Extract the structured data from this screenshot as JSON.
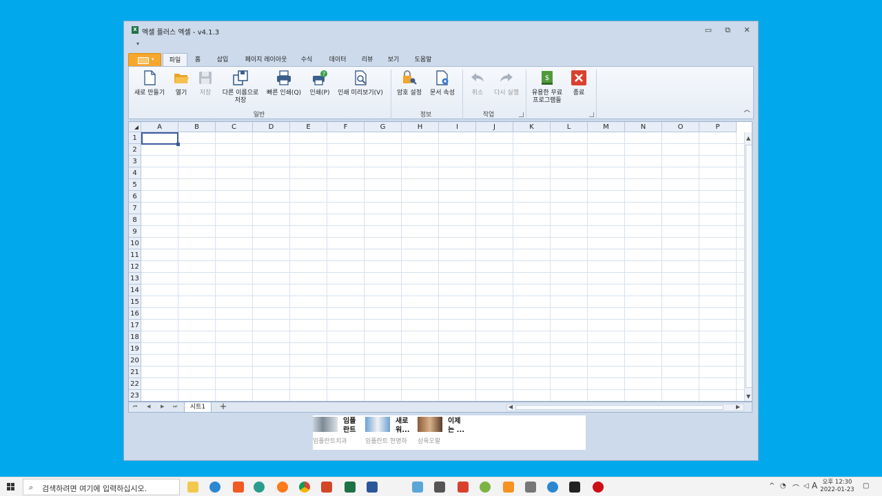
{
  "window": {
    "title": "엑셀 플러스 엑셀 - v4.1.3",
    "app_icon": "X",
    "controls": [
      "▭",
      "⧉",
      "✕"
    ],
    "qat_dropdown": "▾"
  },
  "tabs": [
    {
      "label": "파일",
      "active": true
    },
    {
      "label": "홈"
    },
    {
      "label": "삽입"
    },
    {
      "label": "페이지 레이아웃"
    },
    {
      "label": "수식"
    },
    {
      "label": "데이터"
    },
    {
      "label": "리뷰"
    },
    {
      "label": "보기"
    },
    {
      "label": "도움말"
    }
  ],
  "ribbon": {
    "new": "새로 만들기",
    "open": "열기",
    "save": "저장",
    "save_as_1": "다른 이름으로",
    "save_as_2": "저장",
    "quick_print": "빠른 인쇄(Q)",
    "print": "인쇄(P)",
    "print_preview": "인쇄 미리보기(V)",
    "group_general": "일반",
    "password": "암호 설정",
    "doc_props": "문서 속성",
    "group_info": "정보",
    "undo": "취소",
    "redo": "다시 실행",
    "group_work": "작업",
    "useful_1": "유용한 무료",
    "useful_2": "프로그램들",
    "exit": "종료",
    "collapse": "︿"
  },
  "sheet": {
    "columns": [
      "A",
      "B",
      "C",
      "D",
      "E",
      "F",
      "G",
      "H",
      "I",
      "J",
      "K",
      "L",
      "M",
      "N",
      "O",
      "P"
    ],
    "rows": [
      "1",
      "2",
      "3",
      "4",
      "5",
      "6",
      "7",
      "8",
      "9",
      "10",
      "11",
      "12",
      "13",
      "14",
      "15",
      "16",
      "17",
      "18",
      "19",
      "20",
      "21",
      "22",
      "23"
    ],
    "selected_cell": "A1",
    "sheet_tab": "시트1",
    "add_sheet": "+",
    "nav": [
      "⏮",
      "◀",
      "▶",
      "⏭"
    ]
  },
  "ad": {
    "items": [
      {
        "title1": "임플",
        "title2": "란트",
        "sub": "임플란트치과"
      },
      {
        "title1": "새로",
        "title2": "워...",
        "sub": "임플란트 현명하"
      },
      {
        "title1": "이제",
        "title2": "는 ...",
        "sub": "삼육오팔"
      }
    ]
  },
  "taskbar": {
    "search_placeholder": "검색하려면 여기에 입력하십시오.",
    "search_icon": "⌕",
    "ime": "A",
    "time_1": "오후 12:30",
    "time_2": "2022-01-23"
  },
  "colors": {
    "desktop": "#01a9ec",
    "window": "#ccdaeb",
    "menu_button": "#f7a72d",
    "grid_line": "#d6e1ef"
  }
}
